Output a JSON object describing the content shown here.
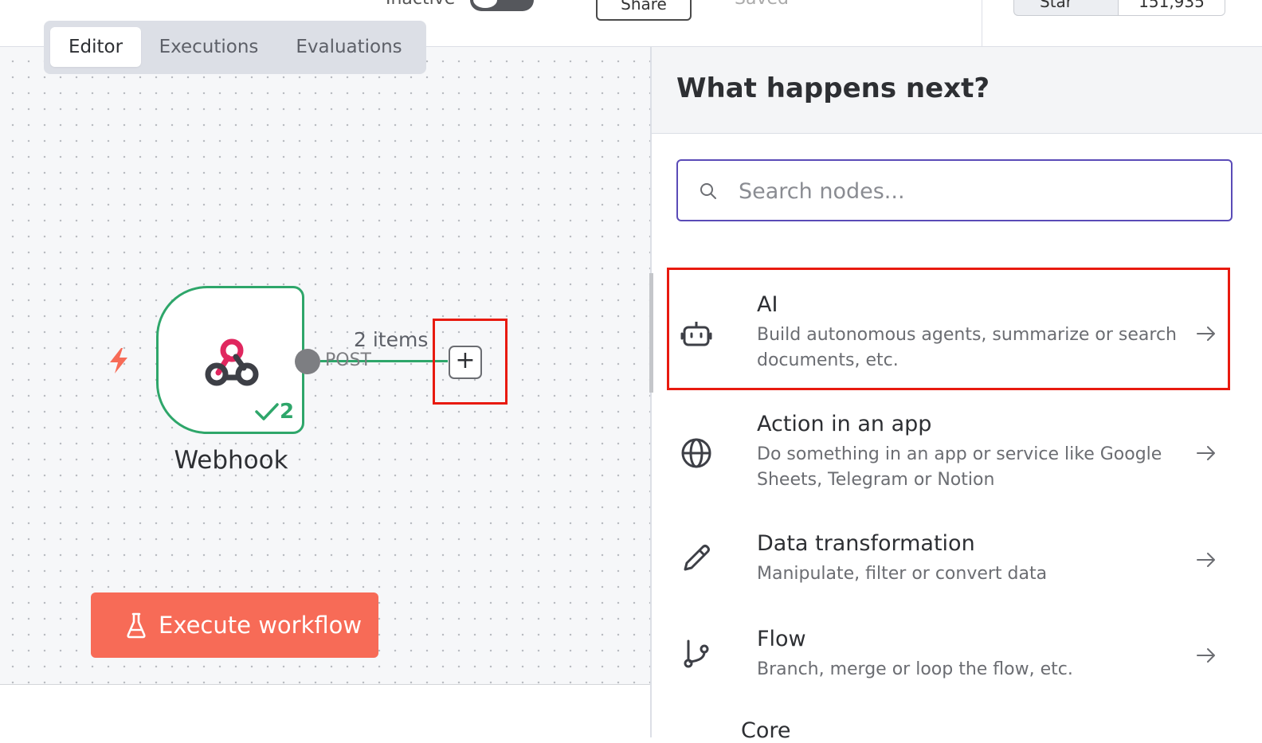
{
  "header": {
    "inactive_label": "Inactive",
    "share_label": "Share",
    "saved_label": "Saved",
    "star_label": "Star",
    "star_count": "151,935"
  },
  "tabs": [
    {
      "label": "Editor",
      "active": true
    },
    {
      "label": "Executions",
      "active": false
    },
    {
      "label": "Evaluations",
      "active": false
    }
  ],
  "canvas": {
    "node": {
      "title": "Webhook",
      "success_count": "2",
      "output_label": "POST",
      "items_label": "2 items"
    },
    "add_node_symbol": "+",
    "execute_button": "Execute workflow"
  },
  "panel": {
    "title": "What happens next?",
    "search_placeholder": "Search nodes...",
    "search_value": "",
    "categories": [
      {
        "title": "AI",
        "desc": "Build autonomous agents, summarize or search documents, etc.",
        "icon": "robot-icon"
      },
      {
        "title": "Action in an app",
        "desc": "Do something in an app or service like Google Sheets, Telegram or Notion",
        "icon": "globe-icon"
      },
      {
        "title": "Data transformation",
        "desc": "Manipulate, filter or convert data",
        "icon": "pencil-icon"
      },
      {
        "title": "Flow",
        "desc": "Branch, merge or loop the flow, etc.",
        "icon": "branch-icon"
      }
    ],
    "next_category_peek": "Core"
  },
  "colors": {
    "accent": "#5a4bb7",
    "success": "#2ea66a",
    "execute": "#f76b57",
    "highlight": "#e81a0f",
    "webhook_pink": "#e0275f"
  }
}
